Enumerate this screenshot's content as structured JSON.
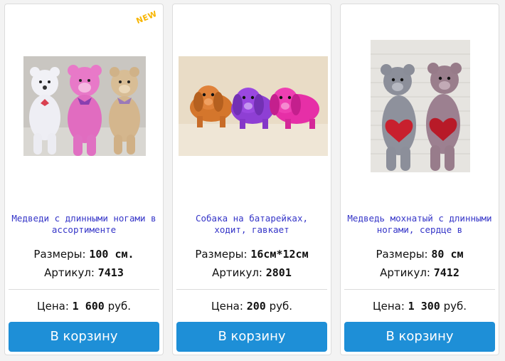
{
  "products": [
    {
      "badge": "NEW",
      "title": "Медведи с длинными ногами в ассортименте",
      "size_label": "Размеры:",
      "size_value": "100 см.",
      "article_label": "Артикул:",
      "article_value": "7413",
      "price_label": "Цена:",
      "price_value": "1 600",
      "price_currency": "руб.",
      "button_label": "В корзину",
      "image": "white, pink and beige teddy bears"
    },
    {
      "title": "Собака на батарейках, ходит, гавкает",
      "size_label": "Размеры:",
      "size_value": "16см*12см",
      "article_label": "Артикул:",
      "article_value": "2801",
      "price_label": "Цена:",
      "price_value": "200",
      "price_currency": "руб.",
      "button_label": "В корзину",
      "image": "orange, purple and pink plush dogs"
    },
    {
      "title": "Медведь мохнатый с длинными ногами, сердце в",
      "size_label": "Размеры:",
      "size_value": "80 см",
      "article_label": "Артикул:",
      "article_value": "7412",
      "price_label": "Цена:",
      "price_value": "1 300",
      "price_currency": "руб.",
      "button_label": "В корзину",
      "image": "grey and mauve shaggy bears with red hearts"
    }
  ],
  "colors": {
    "title_link": "#3535c8",
    "button": "#1e8fd7",
    "badge": "#f7b500"
  }
}
